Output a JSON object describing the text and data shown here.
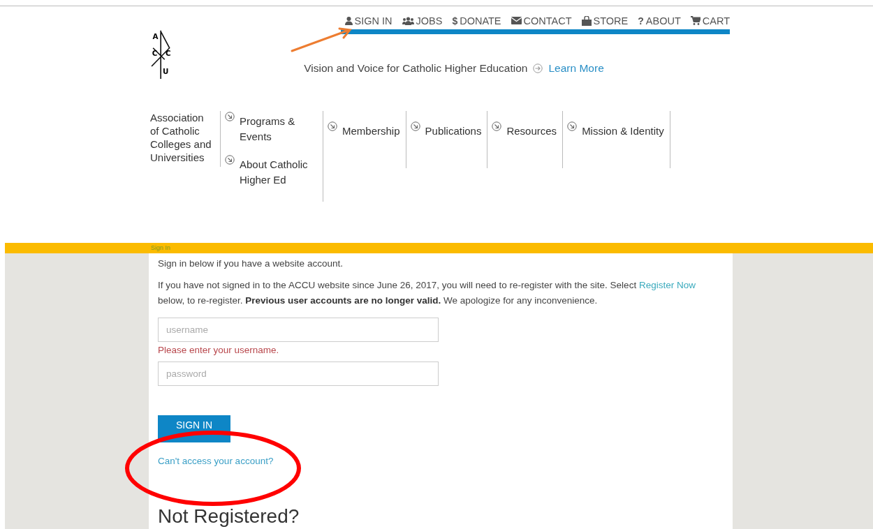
{
  "top_nav": [
    {
      "label": "SIGN IN"
    },
    {
      "label": "JOBS"
    },
    {
      "label": "DONATE",
      "glyph": "$"
    },
    {
      "label": "CONTACT"
    },
    {
      "label": "STORE"
    },
    {
      "label": "ABOUT",
      "glyph": "?"
    },
    {
      "label": "CART"
    }
  ],
  "logo_letters": [
    "A",
    "C",
    "C",
    "U"
  ],
  "tagline": "Vision and Voice for Catholic Higher Education",
  "learn_more": "Learn More",
  "org_name": "Association of Catholic Colleges and Universities",
  "menu": [
    {
      "items": [
        "Programs & Events",
        "About Catholic Higher Ed"
      ]
    },
    {
      "items": [
        "Membership"
      ]
    },
    {
      "items": [
        "Publications"
      ]
    },
    {
      "items": [
        "Resources"
      ]
    },
    {
      "items": [
        "Mission & Identity"
      ]
    }
  ],
  "breadcrumb": "Sign In",
  "intro": "Sign in below if you have a website account.",
  "notice_before": "If you have not signed in to the ACCU website since June 26, 2017, you will need to re-register with the site. Select",
  "notice_link": "Register Now",
  "notice_after": "below, to re-register. **Previous user accounts are no longer valid.** We apologize for any inconvenience.",
  "username": {
    "placeholder": "username",
    "error": "Please enter your username."
  },
  "password": {
    "placeholder": "password"
  },
  "sign_in_button": "SIGN IN",
  "help_link": "Can't access your account?",
  "not_registered_heading": "Not Registered?",
  "annotations": [
    {
      "kind": "arrow"
    },
    {
      "kind": "ellipse"
    }
  ]
}
